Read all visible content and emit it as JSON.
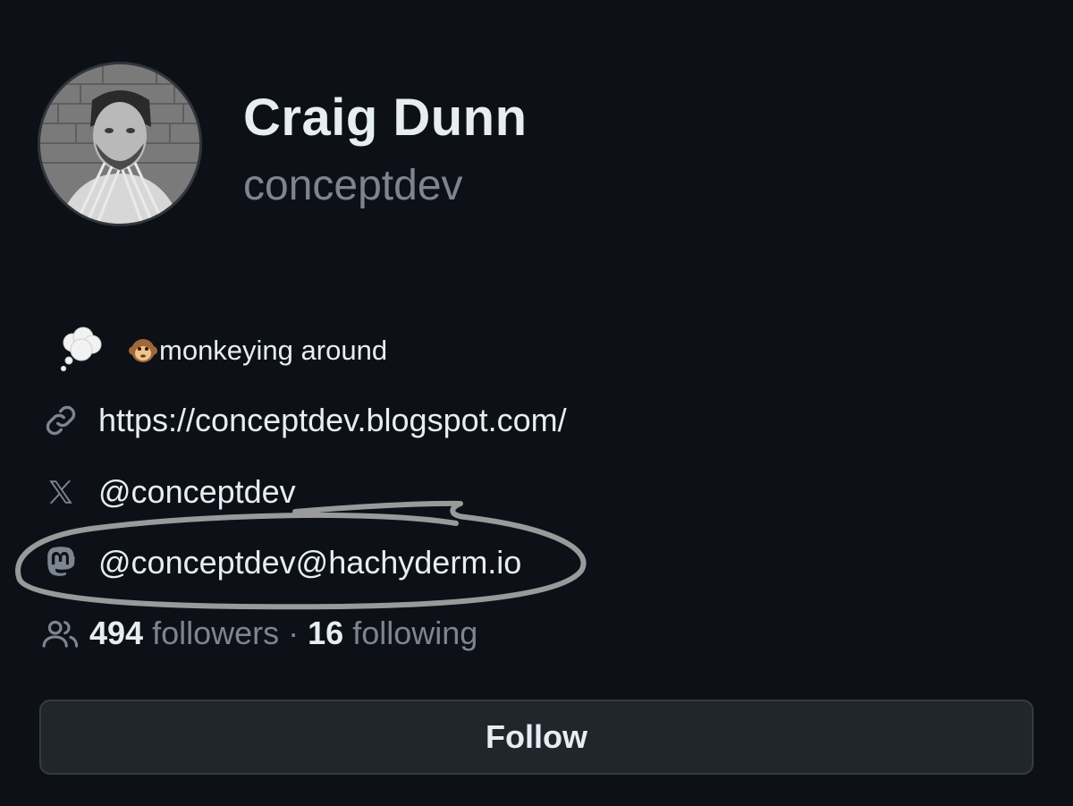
{
  "profile": {
    "name": "Craig Dunn",
    "login": "conceptdev",
    "avatar_icon": "user-avatar-photo"
  },
  "status": {
    "icon": "thought-balloon-icon",
    "emoji": "monkey-face-icon",
    "text": "monkeying around"
  },
  "links": {
    "website": {
      "icon": "link-icon",
      "text": "https://conceptdev.blogspot.com/"
    },
    "x": {
      "icon": "x-logo-icon",
      "text": "@conceptdev"
    },
    "mastodon": {
      "icon": "mastodon-icon",
      "text": "@conceptdev@hachyderm.io"
    }
  },
  "social": {
    "icon": "people-icon",
    "followers_count": "494",
    "followers_label": " followers",
    "separator": " · ",
    "following_count": "16",
    "following_label": " following"
  },
  "follow_button": {
    "label": "Follow"
  },
  "colors": {
    "background": "#0d1117",
    "text_primary": "#e6edf3",
    "text_muted": "#7d8590",
    "button_bg": "#21262d",
    "button_border": "#363b42",
    "annotation_stroke": "#9a9a9a"
  }
}
